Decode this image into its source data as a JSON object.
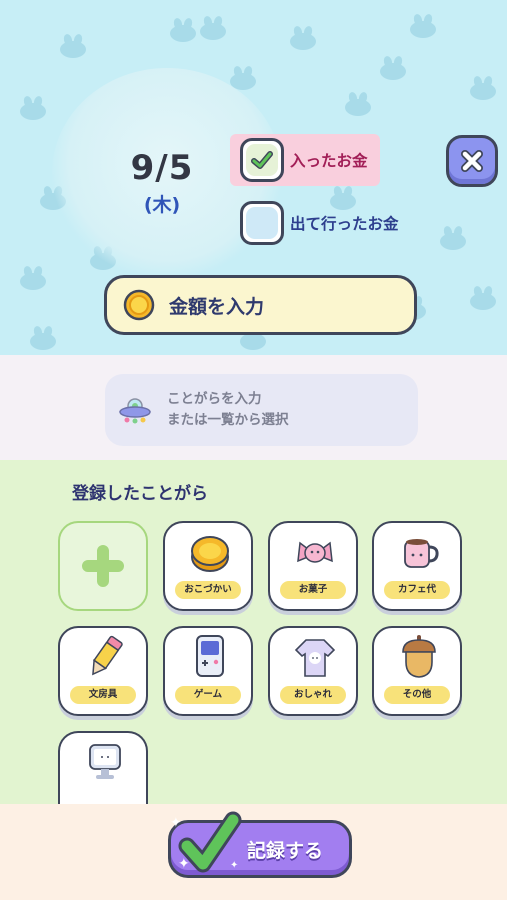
{
  "header": {
    "date": "9/5",
    "weekday": "(木)"
  },
  "type_options": {
    "income_label": "入ったお金",
    "income_checked": true,
    "expense_label": "出て行ったお金",
    "expense_checked": false
  },
  "amount": {
    "label": "金額を入力"
  },
  "item_input": {
    "line1": "ことがらを入力",
    "line2": "または一覧から選択"
  },
  "registered": {
    "title": "登録したことがら",
    "items": [
      {
        "label": "おこづかい",
        "icon": "coin-icon"
      },
      {
        "label": "お菓子",
        "icon": "candy-icon"
      },
      {
        "label": "カフェ代",
        "icon": "mug-icon"
      },
      {
        "label": "文房具",
        "icon": "pencil-icon"
      },
      {
        "label": "ゲーム",
        "icon": "game-console-icon"
      },
      {
        "label": "おしゃれ",
        "icon": "sweater-icon"
      },
      {
        "label": "その他",
        "icon": "acorn-icon"
      }
    ]
  },
  "footer": {
    "record_label": "記録する"
  },
  "colors": {
    "accent_purple": "#a27ef0",
    "close_button": "#8c94ef",
    "label_yellow": "#f8e27a",
    "top_bg": "#c7eef6",
    "grid_bg": "#e2f4d0"
  }
}
